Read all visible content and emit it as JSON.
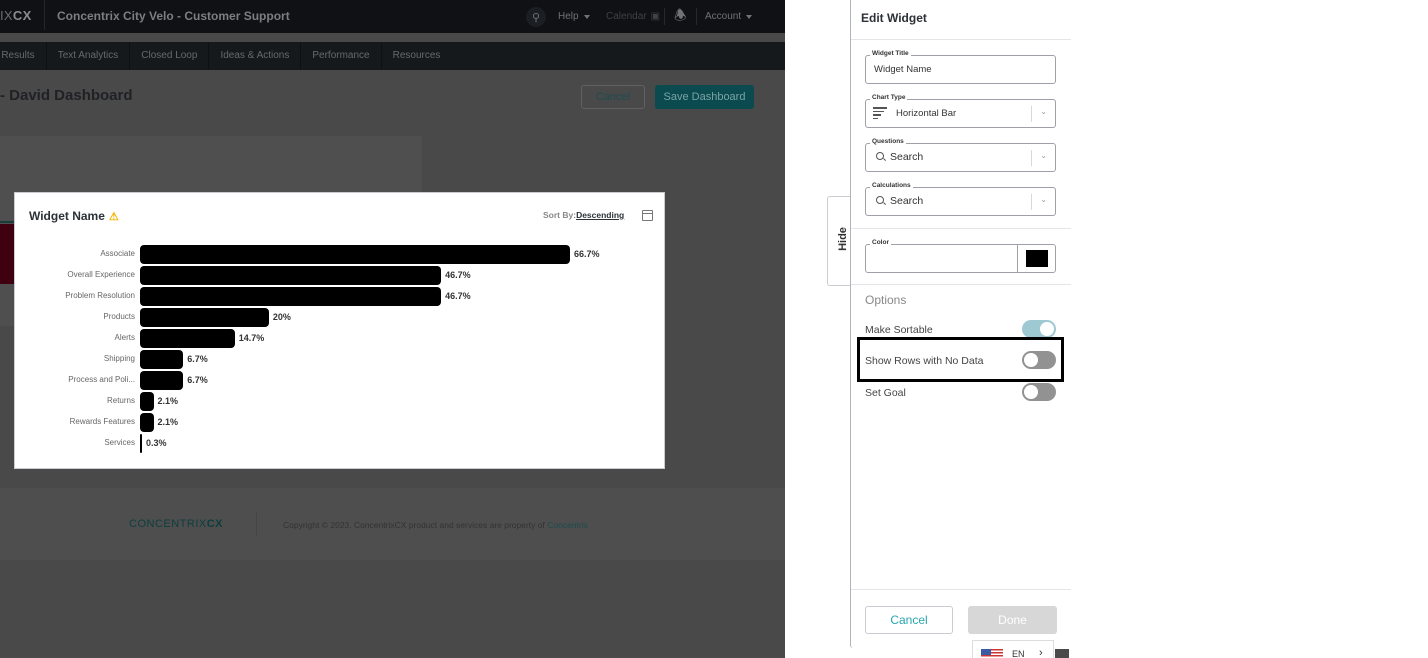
{
  "header": {
    "logo_prefix": "IX",
    "logo_bold": "CX",
    "app_title": "Concentrix City Velo - Customer Support",
    "search_icon": "search-icon",
    "help_label": "Help",
    "calendar_label": "Calendar",
    "bell_icon": "bell-icon",
    "account_label": "Account"
  },
  "subnav": {
    "items": [
      "ey Results",
      "Text Analytics",
      "Closed Loop",
      "Ideas & Actions",
      "Performance",
      "Resources"
    ]
  },
  "dashboard": {
    "title": "- David Dashboard",
    "cancel_label": "Cancel",
    "save_label": "Save Dashboard"
  },
  "footer": {
    "logo_text": "CONCENTRIX",
    "logo_bold": "CX",
    "copyright": "Copyright © 2023. ConcentrixCX product and services are property of ",
    "copyright_link": "Concentrix"
  },
  "widget": {
    "title": "Widget Name",
    "warning_icon": "⚠",
    "sort_label": "Sort By:",
    "sort_value": "Descending"
  },
  "chart_data": {
    "type": "bar",
    "orientation": "horizontal",
    "title": "Widget Name",
    "categories": [
      "Associate",
      "Overall Experience",
      "Problem Resolution",
      "Products",
      "Alerts",
      "Shipping",
      "Process and Poli...",
      "Returns",
      "Rewards Features",
      "Services"
    ],
    "values": [
      66.7,
      46.7,
      46.7,
      20,
      14.7,
      6.7,
      6.7,
      2.1,
      2.1,
      0.3
    ],
    "value_labels": [
      "66.7%",
      "46.7%",
      "46.7%",
      "20%",
      "14.7%",
      "6.7%",
      "6.7%",
      "2.1%",
      "2.1%",
      "0.3%"
    ],
    "xlim": [
      0,
      66.7
    ],
    "color": "#000000",
    "sort": "descending",
    "grid": false
  },
  "panel": {
    "title": "Edit Widget",
    "hide_tab": "Hide",
    "widget_title_legend": "Widget Title",
    "widget_title_value": "Widget Name",
    "chart_type_legend": "Chart Type",
    "chart_type_value": "Horizontal Bar",
    "questions_legend": "Questions",
    "questions_placeholder": "Search",
    "calculations_legend": "Calculations",
    "calculations_placeholder": "Search",
    "color_legend": "Color",
    "color_value": "#000000",
    "options_title": "Options",
    "options": [
      {
        "label": "Make Sortable",
        "on": true
      },
      {
        "label": "Show Rows with No Data",
        "on": false
      },
      {
        "label": "Set Goal",
        "on": false
      }
    ],
    "cancel_label": "Cancel",
    "done_label": "Done"
  },
  "language": {
    "code": "EN",
    "chevron": "›"
  }
}
